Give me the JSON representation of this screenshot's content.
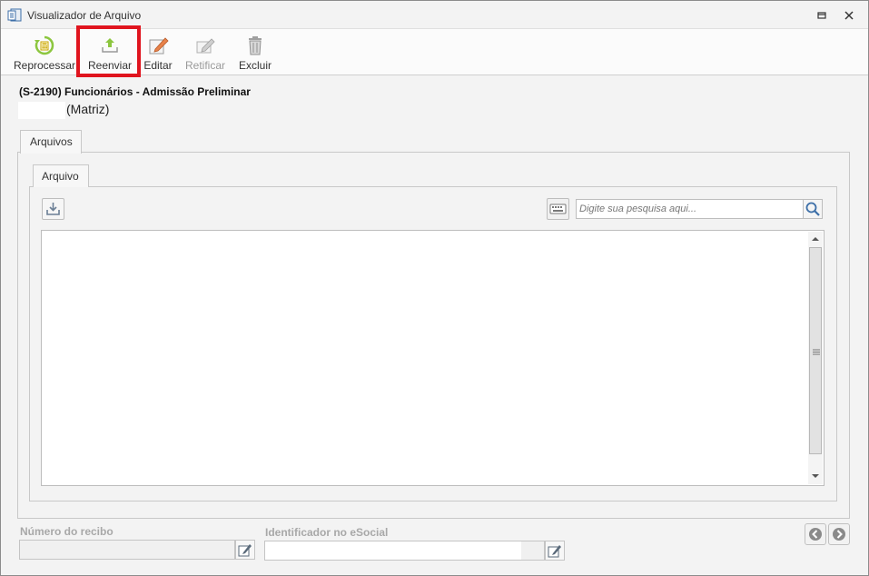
{
  "window": {
    "title": "Visualizador de Arquivo"
  },
  "toolbar": {
    "reprocessar_label": "Reprocessar",
    "reenviar_label": "Reenviar",
    "editar_label": "Editar",
    "retificar_label": "Retificar",
    "excluir_label": "Excluir",
    "icons": [
      "reprocess-icon",
      "upload-icon",
      "edit-icon",
      "rectify-icon",
      "trash-icon"
    ]
  },
  "header": {
    "title": "(S-2190) Funcionários - Admissão Preliminar",
    "company_suffix": "(Matriz)"
  },
  "tabs": {
    "outer_label": "Arquivos",
    "inner_label": "Arquivo"
  },
  "search": {
    "placeholder": "Digite sua pesquisa aqui...",
    "value": ""
  },
  "footer": {
    "recibo_label": "Número do recibo",
    "recibo_value": "",
    "ident_label": "Identificador no eSocial",
    "ident_value": ""
  },
  "colors": {
    "highlight": "#e0141e",
    "upload_icon": "#8cc63f",
    "reprocess_icon": "#8cc63f",
    "nav_icon": "#8a8a8a"
  }
}
